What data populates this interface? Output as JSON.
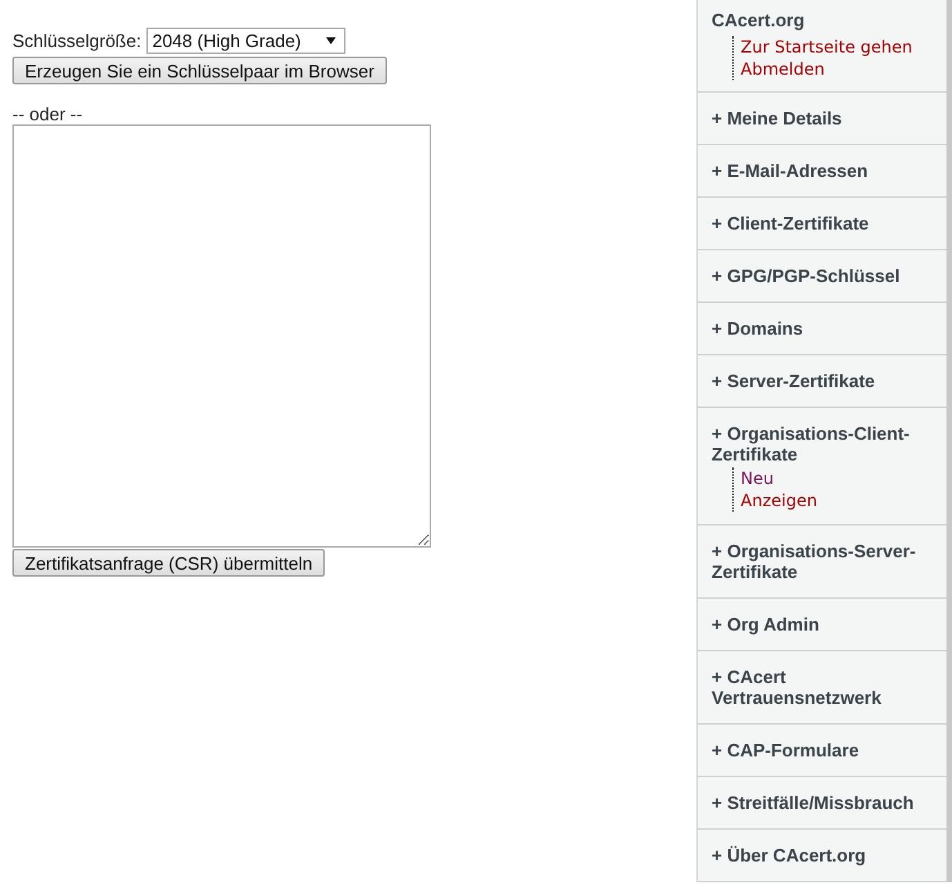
{
  "form": {
    "key_size": {
      "label": "Schlüsselgröße:",
      "value": "2048 (High Grade)"
    },
    "generate_button": "Erzeugen Sie ein Schlüsselpaar im Browser",
    "separator": "-- oder --",
    "submit_button": "Zertifikatsanfrage (CSR) übermitteln"
  },
  "sidebar": {
    "header": {
      "title": "CAcert.org",
      "links": [
        {
          "label": "Zur Startseite gehen",
          "visited": false
        },
        {
          "label": "Abmelden",
          "visited": false
        }
      ]
    },
    "items": [
      {
        "label": "+ Meine Details"
      },
      {
        "label": "+ E-Mail-Adressen"
      },
      {
        "label": "+ Client-Zertifikate"
      },
      {
        "label": "+ GPG/PGP-Schlüssel"
      },
      {
        "label": "+ Domains"
      },
      {
        "label": "+ Server-Zertifikate"
      },
      {
        "label": "+ Organisations-Client-Zertifikate",
        "links": [
          {
            "label": "Neu",
            "visited": true
          },
          {
            "label": "Anzeigen",
            "visited": false
          }
        ]
      },
      {
        "label": "+ Organisations-Server-Zertifikate"
      },
      {
        "label": "+ Org Admin"
      },
      {
        "label": "+ CAcert Vertrauensnetzwerk"
      },
      {
        "label": "+ CAP-Formulare"
      },
      {
        "label": "+ Streitfälle/Missbrauch"
      },
      {
        "label": "+ Über CAcert.org"
      }
    ]
  }
}
